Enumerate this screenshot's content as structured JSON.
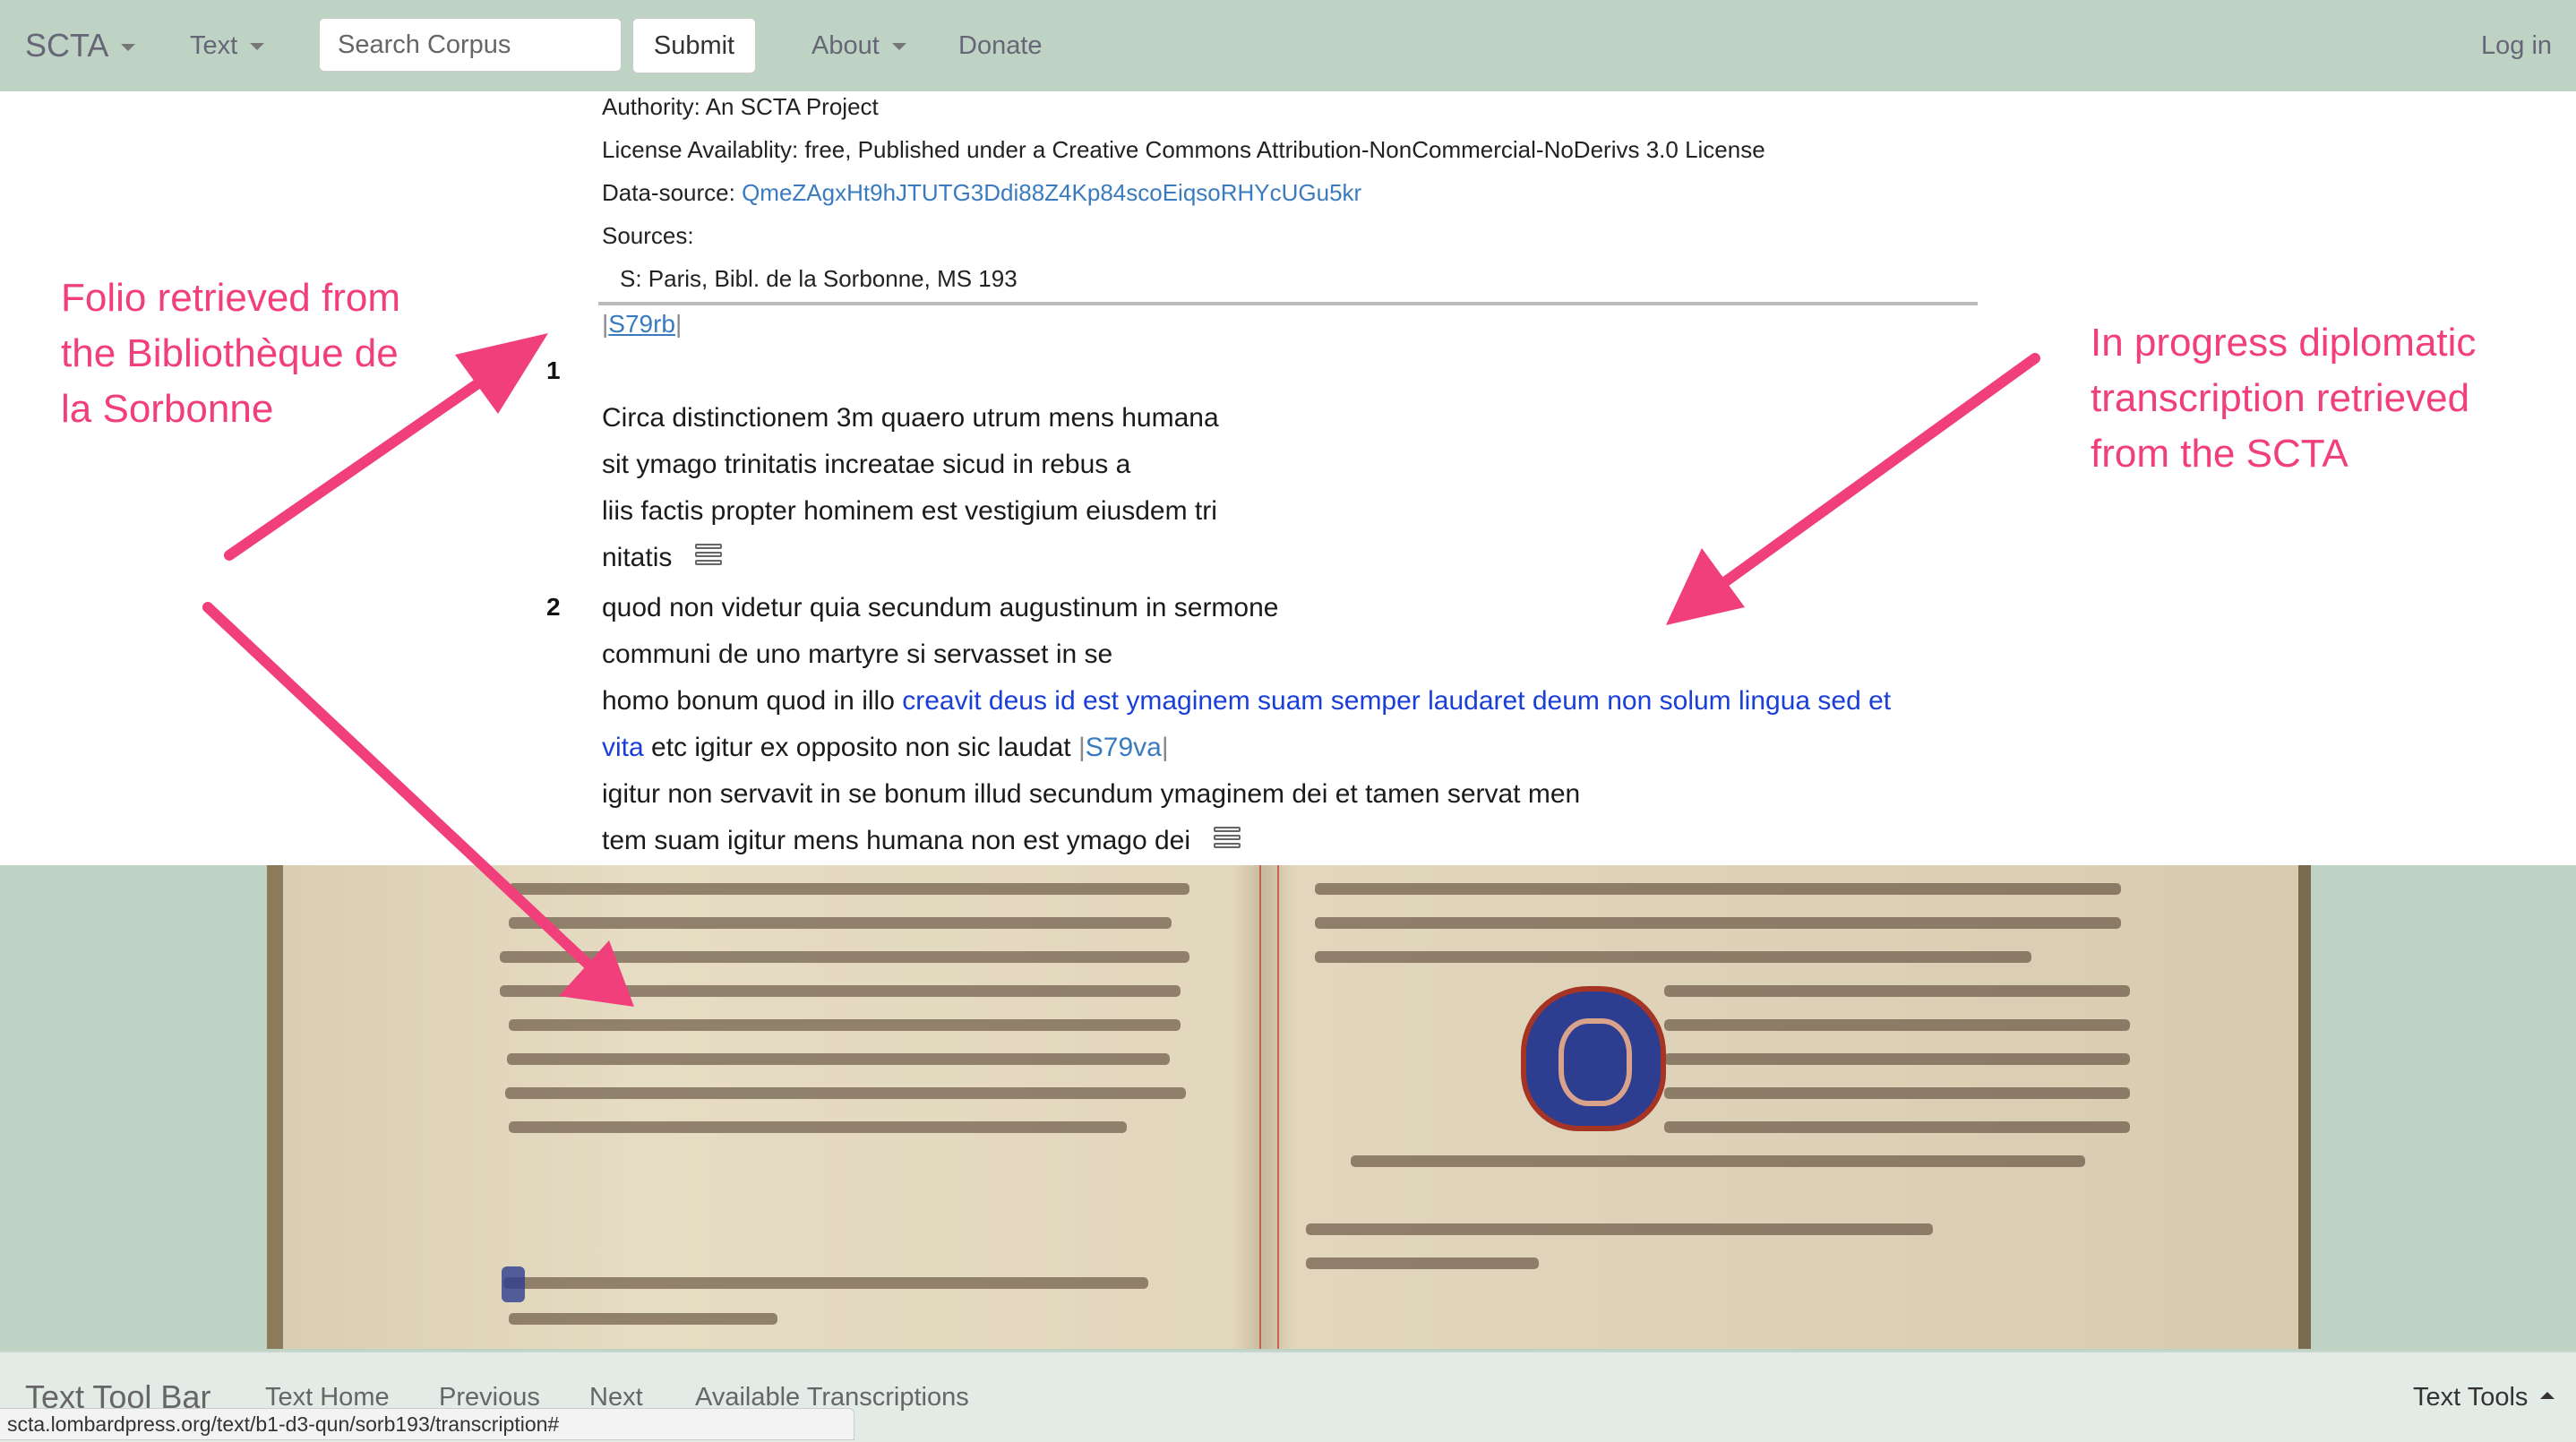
{
  "navbar": {
    "brand": "SCTA",
    "text_menu": "Text",
    "search": {
      "placeholder": "Search Corpus",
      "value": ""
    },
    "submit_label": "Submit",
    "about_menu": "About",
    "donate": "Donate",
    "login": "Log in"
  },
  "metadata": {
    "authority": "Authority: An SCTA Project",
    "license": "License Availablity: free, Published under a Creative Commons Attribution-NonCommercial-NoDerivs 3.0 License",
    "data_source_label": "Data-source:",
    "data_source_value": "QmeZAgxHt9hJTUTG3Ddi88Z4Kp84scoEiqsoRHYcUGu5kr",
    "sources_label": "Sources:",
    "source_item": "S: Paris, Bibl. de la Sorbonne, MS 193"
  },
  "transcription": {
    "folio_start": "S79rb",
    "folio_mid": "S79va",
    "paragraphs": [
      {
        "number": "1",
        "lines": [
          "Circa distinctionem 3m quaero utrum mens humana",
          "sit ymago trinitatis increatae sicud in rebus a",
          "liis factis propter hominem est vestigium eiusdem tri",
          "nitatis"
        ]
      },
      {
        "number": "2",
        "lines": [
          "quod non videtur quia secundum augustinum in sermone",
          "communi de uno martyre si servasset in se"
        ],
        "line3_plain": "homo bonum quod in illo ",
        "line3_blue": "creavit deus id est ymaginem suam semper laudaret deum non solum lingua sed et",
        "line4_blue": "vita",
        "line4_plain": " etc igitur ex opposito non sic laudat",
        "line5": "igitur non servavit in se bonum illud secundum ymaginem dei et tamen servat men",
        "line6": "tem suam igitur mens humana non est ymago dei"
      }
    ]
  },
  "icons": {
    "menu": "options-menu-icon",
    "caret": "caret-down-icon"
  },
  "toolbar": {
    "title": "Text Tool Bar",
    "home": "Text Home",
    "previous": "Previous",
    "next": "Next",
    "available": "Available Transcriptions",
    "tools": "Text Tools"
  },
  "status_bar_url": "scta.lombardpress.org/text/b1-d3-qun/sorb193/transcription#",
  "annotations": {
    "left": "Folio retrieved from\nthe Bibliothèque de\nla Sorbonne",
    "right": "In progress diplomatic\ntranscription retrieved\nfrom the SCTA",
    "color": "#f13f7b"
  },
  "colors": {
    "navbar_bg": "#bfd3c5",
    "link": "#3a7bbf",
    "highlight_text": "#1a3ed8"
  }
}
